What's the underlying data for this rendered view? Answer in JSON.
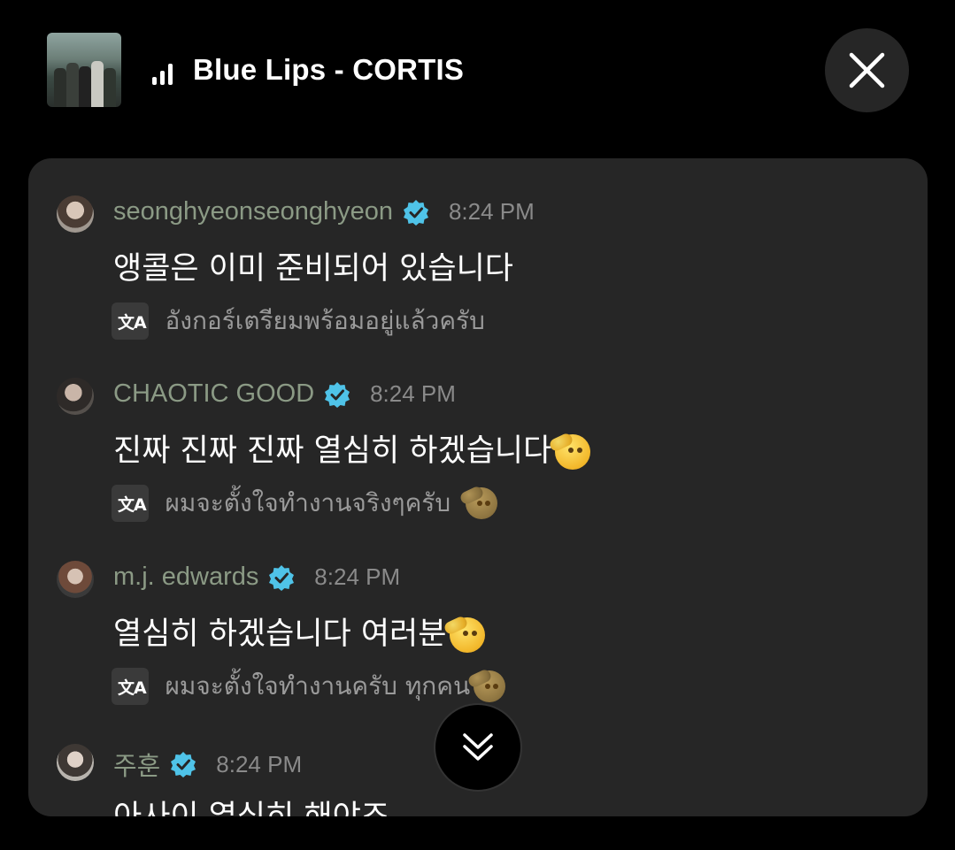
{
  "now_playing": {
    "track": "Blue Lips - CORTIS",
    "album_art": "album-cover-image",
    "playing_indicator": "equalizer-bars-icon"
  },
  "controls": {
    "close_icon": "close-icon",
    "scroll_down_icon": "chevron-double-down-icon"
  },
  "messages": [
    {
      "username": "seonghyeonseonghyeon",
      "verified": true,
      "time": "8:24 PM",
      "text": "앵콜은 이미 준비되어 있습니다",
      "translation": "อังกอร์เตรียมพร้อมอยู่แล้วครับ"
    },
    {
      "username": "CHAOTIC GOOD",
      "verified": true,
      "time": "8:24 PM",
      "text": "진짜 진짜 진짜 열심히 하겠습니다",
      "text_emoji": "saluting-face",
      "translation": "ผมจะตั้งใจทำงานจริงๆครับ",
      "translation_emoji": "saluting-face"
    },
    {
      "username": "m.j. edwards",
      "verified": true,
      "time": "8:24 PM",
      "text": "열심히 하겠습니다 여러분",
      "text_emoji": "saluting-face",
      "translation": "ผมจะตั้งใจทำงานครับ ทุกคน",
      "translation_emoji": "saluting-face"
    },
    {
      "username": "주훈",
      "verified": true,
      "time": "8:24 PM",
      "text": "아사이 열심히 해야죠"
    }
  ],
  "colors": {
    "background": "#000000",
    "panel": "#262626",
    "username": "#8b9a85",
    "verified_badge": "#4fc3e8",
    "timestamp": "#8a8a8a"
  }
}
